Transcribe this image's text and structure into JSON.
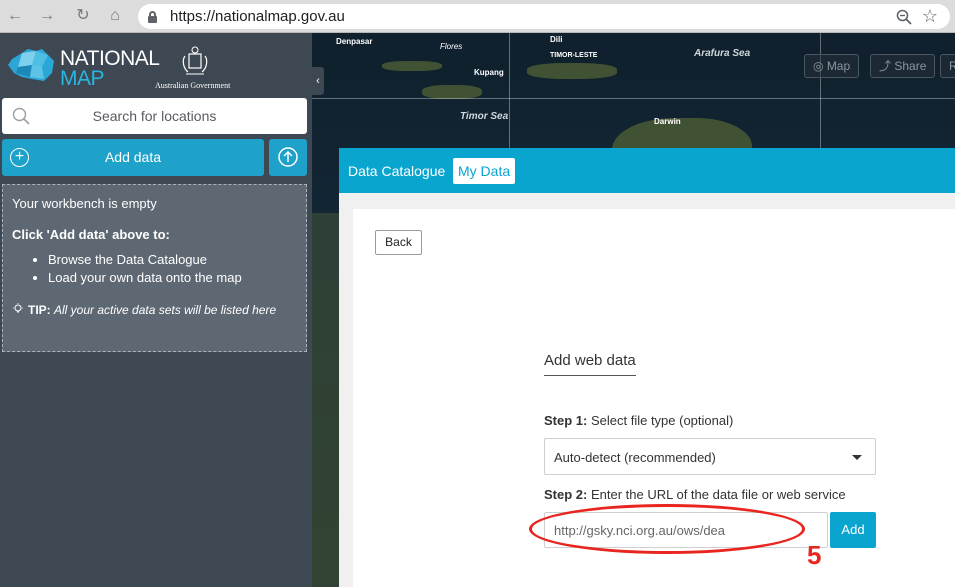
{
  "browser": {
    "url": "https://nationalmap.gov.au",
    "back_glyph": "←",
    "forward_glyph": "→",
    "reload_glyph": "↻",
    "home_glyph": "⌂",
    "star_glyph": "☆"
  },
  "sidebar": {
    "logo_line1": "NATIONAL",
    "logo_line2": "MAP",
    "gov_text": "Australian Government",
    "search_placeholder": "Search for locations",
    "add_data_label": "Add data",
    "plus_glyph": "+",
    "collapse_glyph": "‹",
    "workbench": {
      "title": "Your workbench is empty",
      "instruction": "Click 'Add data' above to:",
      "items": [
        "Browse the Data Catalogue",
        "Load your own data onto the map"
      ],
      "tip_label": "TIP:",
      "tip_text": "All your active data sets will be listed here"
    }
  },
  "map": {
    "places": [
      "Denpasar",
      "Flores",
      "Dili",
      "TIMOR-LESTE",
      "Kupang",
      "Darwin"
    ],
    "seas": [
      "Arafura Sea",
      "Timor Sea"
    ],
    "buttons": [
      "Map",
      "Share",
      "R"
    ]
  },
  "panel": {
    "tabs": [
      {
        "label": "Data Catalogue",
        "active": false
      },
      {
        "label": "My Data",
        "active": true
      }
    ],
    "back_label": "Back",
    "section_title": "Add web data",
    "step1_label": "Step 1:",
    "step1_text": "Select file type (optional)",
    "select_value": "Auto-detect (recommended)",
    "step2_label": "Step 2:",
    "step2_text": "Enter the URL of the data file or web service",
    "url_value": "http://gsky.nci.org.au/ows/dea",
    "add_label": "Add"
  },
  "annotation": {
    "number": "5",
    "color": "#e8251f"
  },
  "colors": {
    "accent": "#1fa2c9",
    "panel_header": "#0aa5cf",
    "sidebar_bg": "#3e4852"
  }
}
